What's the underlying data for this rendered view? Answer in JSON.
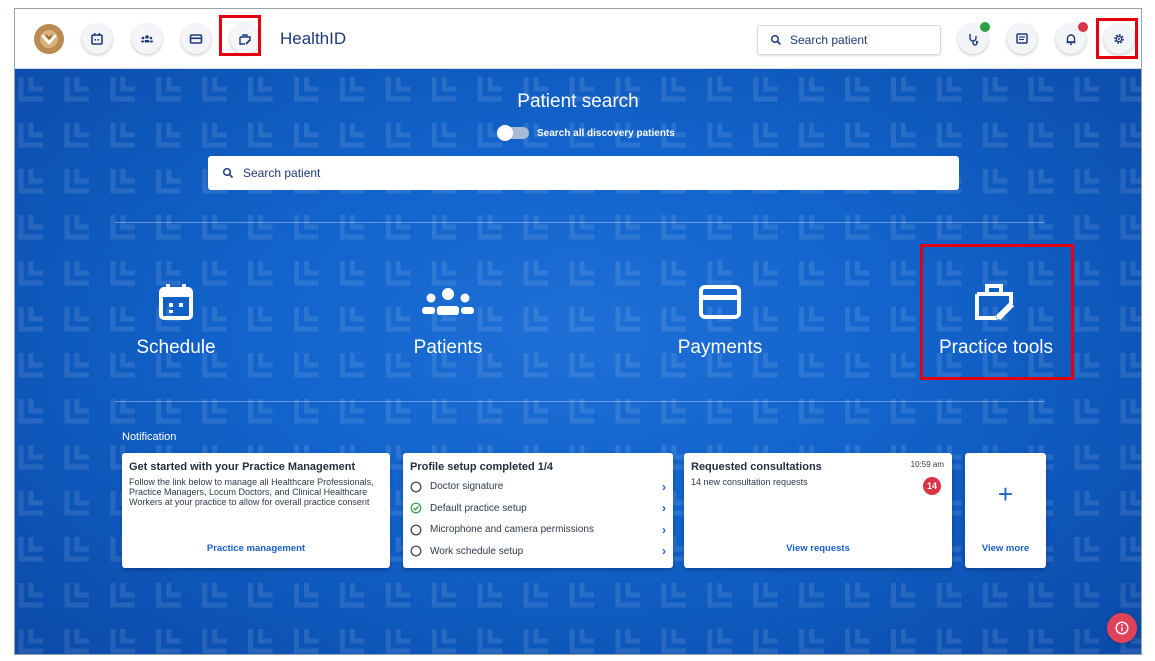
{
  "header": {
    "app_title": "HealthID",
    "search_placeholder": "Search patient",
    "nav_icons": [
      "calendar-icon",
      "group-icon",
      "card-icon",
      "briefcase-edit-icon"
    ],
    "right_icons": [
      "stethoscope-icon",
      "message-icon",
      "bell-icon",
      "gear-icon"
    ]
  },
  "hero": {
    "title": "Patient search",
    "toggle_label": "Search all discovery patients",
    "search_placeholder": "Search patient"
  },
  "tiles": [
    {
      "label": "Schedule",
      "icon": "calendar-icon"
    },
    {
      "label": "Patients",
      "icon": "group-icon"
    },
    {
      "label": "Payments",
      "icon": "card-icon"
    },
    {
      "label": "Practice tools",
      "icon": "briefcase-edit-icon"
    }
  ],
  "notifications": {
    "label": "Notification",
    "practice": {
      "title": "Get started with your Practice Management",
      "text": "Follow the link below to manage all Healthcare Professionals, Practice Managers, Locum Doctors, and Clinical Healthcare Workers at your practice to allow for overall practice consent",
      "link": "Practice management"
    },
    "profile": {
      "title": "Profile setup completed 1/4",
      "items": [
        {
          "label": "Doctor signature",
          "done": false
        },
        {
          "label": "Default practice setup",
          "done": true
        },
        {
          "label": "Microphone and camera permissions",
          "done": false
        },
        {
          "label": "Work schedule setup",
          "done": false
        }
      ]
    },
    "consultations": {
      "title": "Requested consultations",
      "time": "10:59 am",
      "text": "14 new consultation requests",
      "count": "14",
      "link": "View requests"
    },
    "more": {
      "icon_text": "+",
      "link": "View more"
    }
  },
  "colors": {
    "brand_blue": "#1264cc",
    "link_blue": "#1a5fc6",
    "highlight_red": "#e3000f",
    "badge_red": "#d63447",
    "status_green": "#2e9e44"
  }
}
